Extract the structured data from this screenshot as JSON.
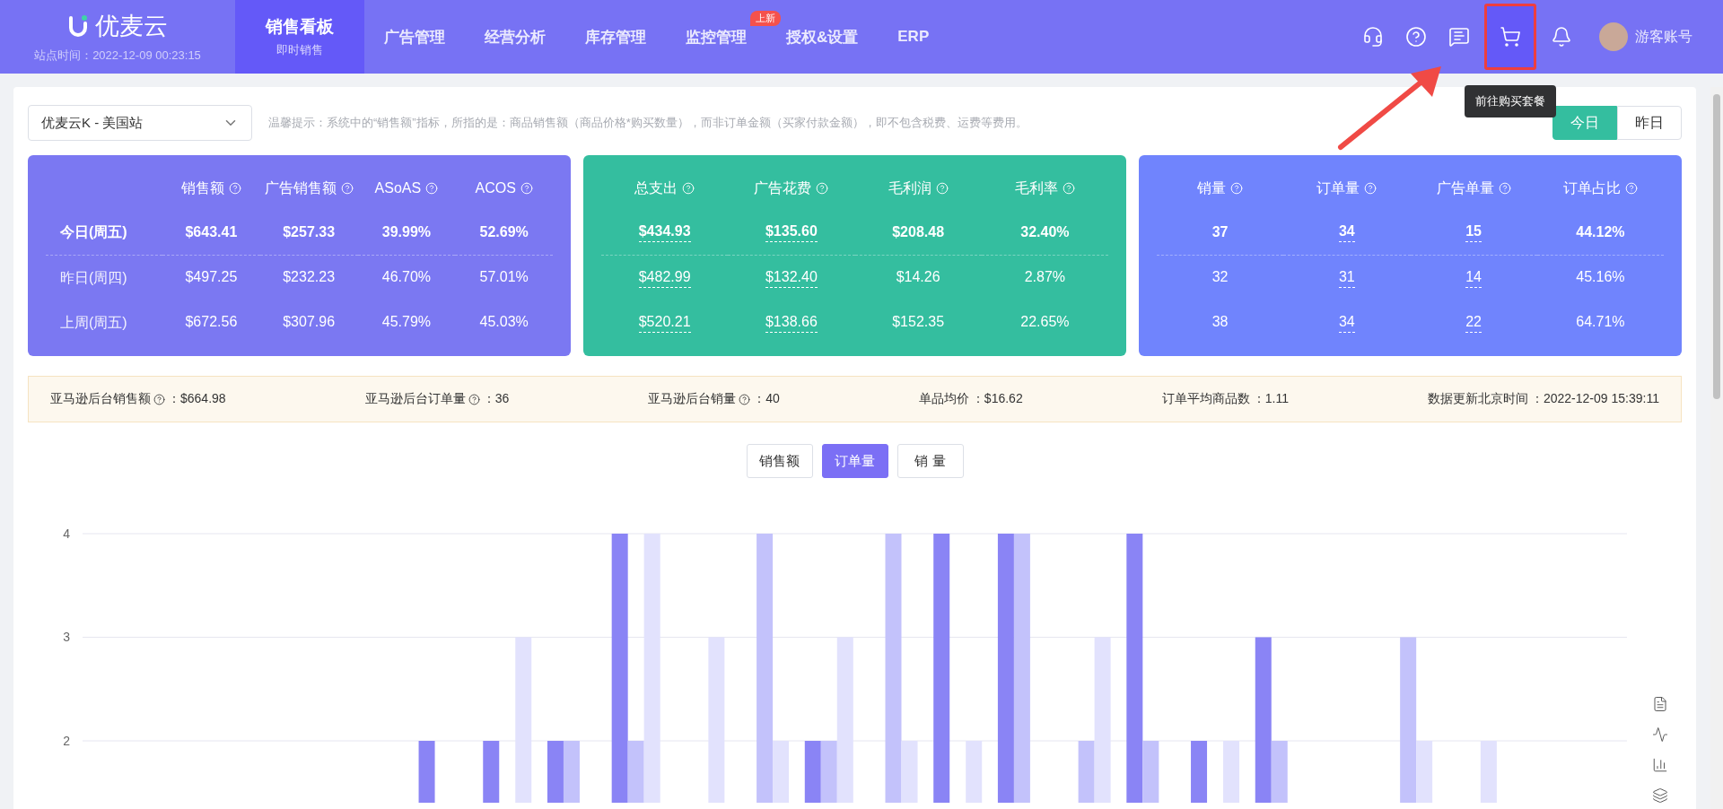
{
  "header": {
    "logo": "优麦云",
    "site_time": "站点时间：2022-12-09 00:23:15",
    "nav": [
      {
        "label": "销售看板",
        "sublabel": "即时销售",
        "selected": true
      },
      {
        "label": "广告管理",
        "selected": false
      },
      {
        "label": "经营分析",
        "selected": false
      },
      {
        "label": "库存管理",
        "selected": false
      },
      {
        "label": "监控管理",
        "selected": false,
        "badge": "上新"
      },
      {
        "label": "授权&设置",
        "selected": false
      },
      {
        "label": "ERP",
        "selected": false
      }
    ],
    "icons": [
      {
        "kind": "support",
        "annotated": false
      },
      {
        "kind": "help",
        "annotated": false
      },
      {
        "kind": "message",
        "annotated": false
      },
      {
        "kind": "cart",
        "annotated": true,
        "tooltip": "前往购买套餐"
      },
      {
        "kind": "bell",
        "annotated": false
      }
    ],
    "account": "游客账号"
  },
  "toolbar": {
    "store": "优麦云K - 美国站",
    "hint": "温馨提示：系统中的“销售额”指标，所指的是：商品销售额（商品价格*购买数量），而非订单金额（买家付款金额），即不包含税费、运费等费用。",
    "days": [
      {
        "label": "今日",
        "selected": true
      },
      {
        "label": "昨日",
        "selected": false
      }
    ]
  },
  "cards": [
    {
      "color": "#7b78f2",
      "columns": [
        "销售额",
        "广告销售额",
        "ASoAS",
        "ACOS"
      ],
      "rows": [
        {
          "label": "今日(周五)",
          "bold": true,
          "cells": [
            {
              "value": "$643.41",
              "link": false
            },
            {
              "value": "$257.33",
              "link": false
            },
            {
              "value": "39.99%",
              "link": false
            },
            {
              "value": "52.69%",
              "link": false
            }
          ]
        },
        {
          "label": "昨日(周四)",
          "bold": false,
          "cells": [
            {
              "value": "$497.25",
              "link": false
            },
            {
              "value": "$232.23",
              "link": false
            },
            {
              "value": "46.70%",
              "link": false
            },
            {
              "value": "57.01%",
              "link": false
            }
          ]
        },
        {
          "label": "上周(周五)",
          "bold": false,
          "cells": [
            {
              "value": "$672.56",
              "link": false
            },
            {
              "value": "$307.96",
              "link": false
            },
            {
              "value": "45.79%",
              "link": false
            },
            {
              "value": "45.03%",
              "link": false
            }
          ]
        }
      ]
    },
    {
      "color": "#34be9f",
      "columns": [
        "总支出",
        "广告花费",
        "毛利润",
        "毛利率"
      ],
      "rows": [
        {
          "bold": true,
          "cells": [
            {
              "value": "$434.93",
              "link": true
            },
            {
              "value": "$135.60",
              "link": true
            },
            {
              "value": "$208.48",
              "link": false
            },
            {
              "value": "32.40%",
              "link": false
            }
          ]
        },
        {
          "bold": false,
          "cells": [
            {
              "value": "$482.99",
              "link": true
            },
            {
              "value": "$132.40",
              "link": true
            },
            {
              "value": "$14.26",
              "link": false
            },
            {
              "value": "2.87%",
              "link": false
            }
          ]
        },
        {
          "bold": false,
          "cells": [
            {
              "value": "$520.21",
              "link": true
            },
            {
              "value": "$138.66",
              "link": true
            },
            {
              "value": "$152.35",
              "link": false
            },
            {
              "value": "22.65%",
              "link": false
            }
          ]
        }
      ]
    },
    {
      "color": "#7084fd",
      "columns": [
        "销量",
        "订单量",
        "广告单量",
        "订单占比"
      ],
      "rows": [
        {
          "bold": true,
          "cells": [
            {
              "value": "37",
              "link": false
            },
            {
              "value": "34",
              "link": true
            },
            {
              "value": "15",
              "link": true
            },
            {
              "value": "44.12%",
              "link": false
            }
          ]
        },
        {
          "bold": false,
          "cells": [
            {
              "value": "32",
              "link": false
            },
            {
              "value": "31",
              "link": true
            },
            {
              "value": "14",
              "link": true
            },
            {
              "value": "45.16%",
              "link": false
            }
          ]
        },
        {
          "bold": false,
          "cells": [
            {
              "value": "38",
              "link": false
            },
            {
              "value": "34",
              "link": true
            },
            {
              "value": "22",
              "link": true
            },
            {
              "value": "64.71%",
              "link": false
            }
          ]
        }
      ]
    }
  ],
  "summary": [
    {
      "label": "亚马逊后台销售额",
      "help": true,
      "value": "：$664.98"
    },
    {
      "label": "亚马逊后台订单量",
      "help": true,
      "value": "：36"
    },
    {
      "label": "亚马逊后台销量",
      "help": true,
      "value": "：40"
    },
    {
      "label": "单品均价",
      "help": false,
      "value": "：$16.62"
    },
    {
      "label": "订单平均商品数",
      "help": false,
      "value": "：1.11"
    },
    {
      "label": "数据更新北京时间",
      "help": false,
      "value": "：2022-12-09 15:39:11"
    }
  ],
  "metric_tabs": [
    {
      "label": "销售额",
      "selected": false
    },
    {
      "label": "订单量",
      "selected": true
    },
    {
      "label": "销 量",
      "selected": false
    }
  ],
  "chart": {
    "chart_data": {
      "type": "bar",
      "ylim": [
        1.4,
        4
      ],
      "grid": true,
      "yticks": [
        2,
        3,
        4
      ],
      "series": [
        {
          "color": "#8a84f5",
          "values": [
            null,
            null,
            null,
            null,
            null,
            2,
            2,
            2,
            4,
            null,
            null,
            2,
            null,
            4,
            4,
            null,
            4,
            2,
            3,
            null,
            null,
            null,
            null,
            null
          ]
        },
        {
          "color": "#c3c2fb",
          "values": [
            null,
            null,
            null,
            null,
            null,
            null,
            null,
            2,
            2,
            null,
            4,
            2,
            4,
            null,
            4,
            2,
            2,
            null,
            2,
            null,
            3,
            null,
            null,
            null
          ]
        },
        {
          "color": "#e2e2fd",
          "values": [
            null,
            null,
            null,
            null,
            null,
            null,
            3,
            null,
            4,
            3,
            2,
            3,
            2,
            2,
            null,
            3,
            null,
            2,
            null,
            null,
            2,
            2,
            null,
            null
          ]
        }
      ]
    }
  }
}
